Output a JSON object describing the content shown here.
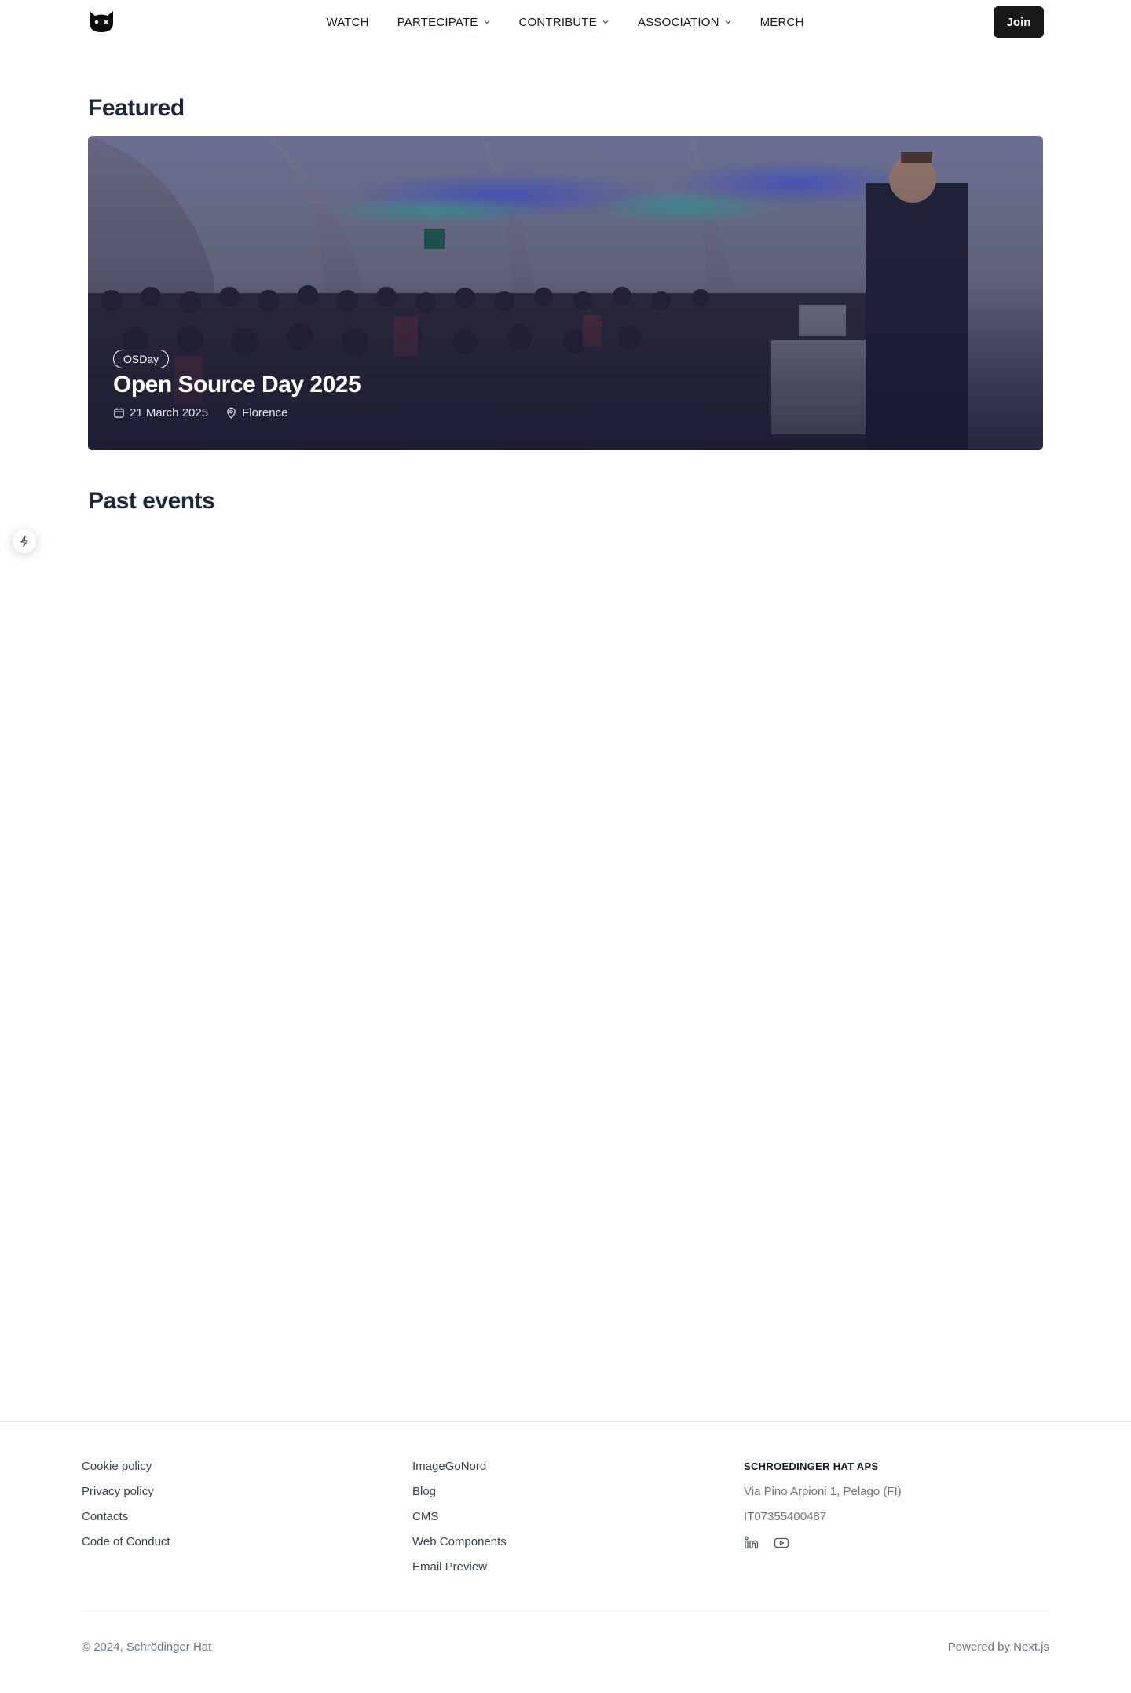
{
  "header": {
    "logo_icon": "cat-logo-icon",
    "nav": [
      {
        "label": "WATCH",
        "dropdown": false
      },
      {
        "label": "PARTECIPATE",
        "dropdown": true
      },
      {
        "label": "CONTRIBUTE",
        "dropdown": true
      },
      {
        "label": "ASSOCIATION",
        "dropdown": true
      },
      {
        "label": "MERCH",
        "dropdown": false
      }
    ],
    "join_label": "Join"
  },
  "featured": {
    "section_title": "Featured",
    "tag": "OSDay",
    "title": "Open Source Day 2025",
    "date": "21 March 2025",
    "location": "Florence"
  },
  "past": {
    "section_title": "Past events"
  },
  "footer": {
    "col1": [
      "Cookie policy",
      "Privacy policy",
      "Contacts",
      "Code of Conduct"
    ],
    "col2": [
      "ImageGoNord",
      "Blog",
      "CMS",
      "Web Components",
      "Email Preview"
    ],
    "company": {
      "name": "SCHROEDINGER HAT APS",
      "address": "Via Pino Arpioni 1, Pelago (FI)",
      "vat": "IT07355400487"
    },
    "copyright": "© 2024, Schrödinger Hat",
    "powered": "Powered by Next.js"
  },
  "colors": {
    "join_bg": "#18181b",
    "heading": "#1e293b",
    "muted": "#64748b"
  }
}
